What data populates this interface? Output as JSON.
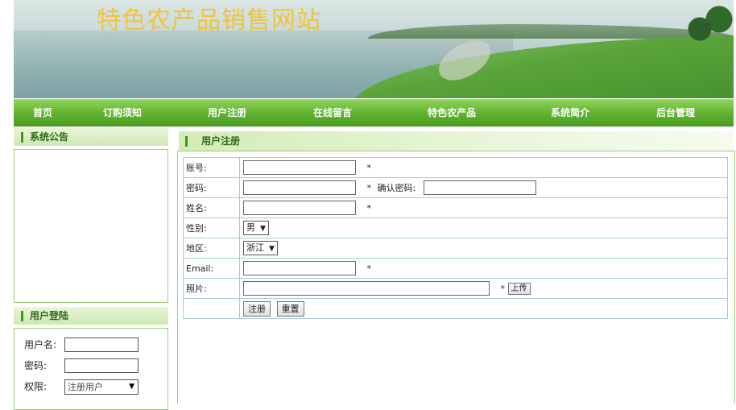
{
  "site": {
    "title": "特色农产品销售网站"
  },
  "nav": {
    "items": [
      {
        "label": "首页"
      },
      {
        "label": "订购须知"
      },
      {
        "label": "用户注册"
      },
      {
        "label": "在线留言"
      },
      {
        "label": "特色农产品"
      },
      {
        "label": "系统简介"
      },
      {
        "label": "后台管理"
      }
    ]
  },
  "sidebar": {
    "announcement": {
      "title": "系统公告"
    },
    "login": {
      "title": "用户登陆",
      "username_label": "用户名:",
      "password_label": "密码:",
      "role_label": "权限:",
      "role_value": "注册用户"
    }
  },
  "register": {
    "title": "用户注册",
    "account_label": "账号:",
    "password_label": "密码:",
    "confirm_label": "确认密码:",
    "name_label": "姓名:",
    "gender_label": "性别:",
    "gender_value": "男",
    "region_label": "地区:",
    "region_value": "浙江",
    "email_label": "Email:",
    "photo_label": "照片:",
    "required_mark": "*",
    "upload_label": "上传",
    "submit_label": "注册",
    "reset_label": "重置"
  },
  "colors": {
    "nav_green": "#5fb12f",
    "title_gold": "#f2c23a",
    "panel_text": "#2f6a16"
  }
}
